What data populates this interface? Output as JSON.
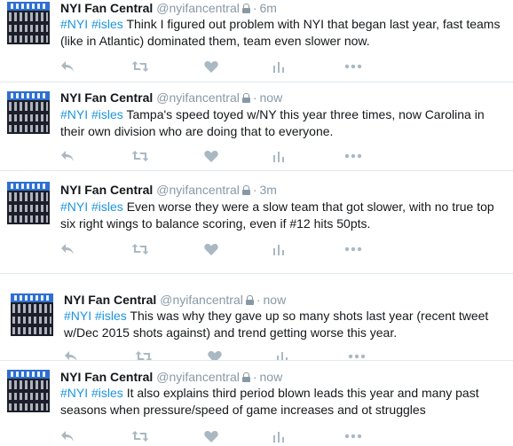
{
  "tweets": [
    {
      "name": "NYI Fan Central",
      "handle": "@nyifancentral",
      "time": "6m",
      "tags": [
        "#NYI",
        "#isles"
      ],
      "body": "Think I figured out problem with NYI that began last year, fast teams (like in Atlantic) dominated them, team even slower now."
    },
    {
      "name": "NYI Fan Central",
      "handle": "@nyifancentral",
      "time": "now",
      "tags": [
        "#NYI",
        "#isles"
      ],
      "body": "Tampa's speed toyed w/NY this year three times, now Carolina in their own division who are doing that to everyone."
    },
    {
      "name": "NYI Fan Central",
      "handle": "@nyifancentral",
      "time": "3m",
      "tags": [
        "#NYI",
        "#isles"
      ],
      "body": "Even worse they were a slow team that got slower, with no true top six right wings to balance scoring, even if #12 hits 50pts."
    },
    {
      "name": "NYI Fan Central",
      "handle": "@nyifancentral",
      "time": "now",
      "tags": [
        "#NYI",
        "#isles"
      ],
      "body": "This was why they gave up so many shots last year (recent tweet w/Dec 2015 shots against) and trend getting worse this year."
    },
    {
      "name": "NYI Fan Central",
      "handle": "@nyifancentral",
      "time": "now",
      "tags": [
        "#NYI",
        "#isles"
      ],
      "body": "It also explains third period blown leads this year and many past seasons when pressure/speed of game increases and ot struggles"
    }
  ],
  "icons": {
    "reply": "reply-icon",
    "retweet": "retweet-icon",
    "like": "heart-icon",
    "analytics": "analytics-icon",
    "more": "more-icon",
    "lock": "lock-icon"
  },
  "colors": {
    "hashtag": "#1b95e0",
    "muted": "#8899a6",
    "icon": "#aab8c2",
    "divider": "#e1e8ed"
  }
}
